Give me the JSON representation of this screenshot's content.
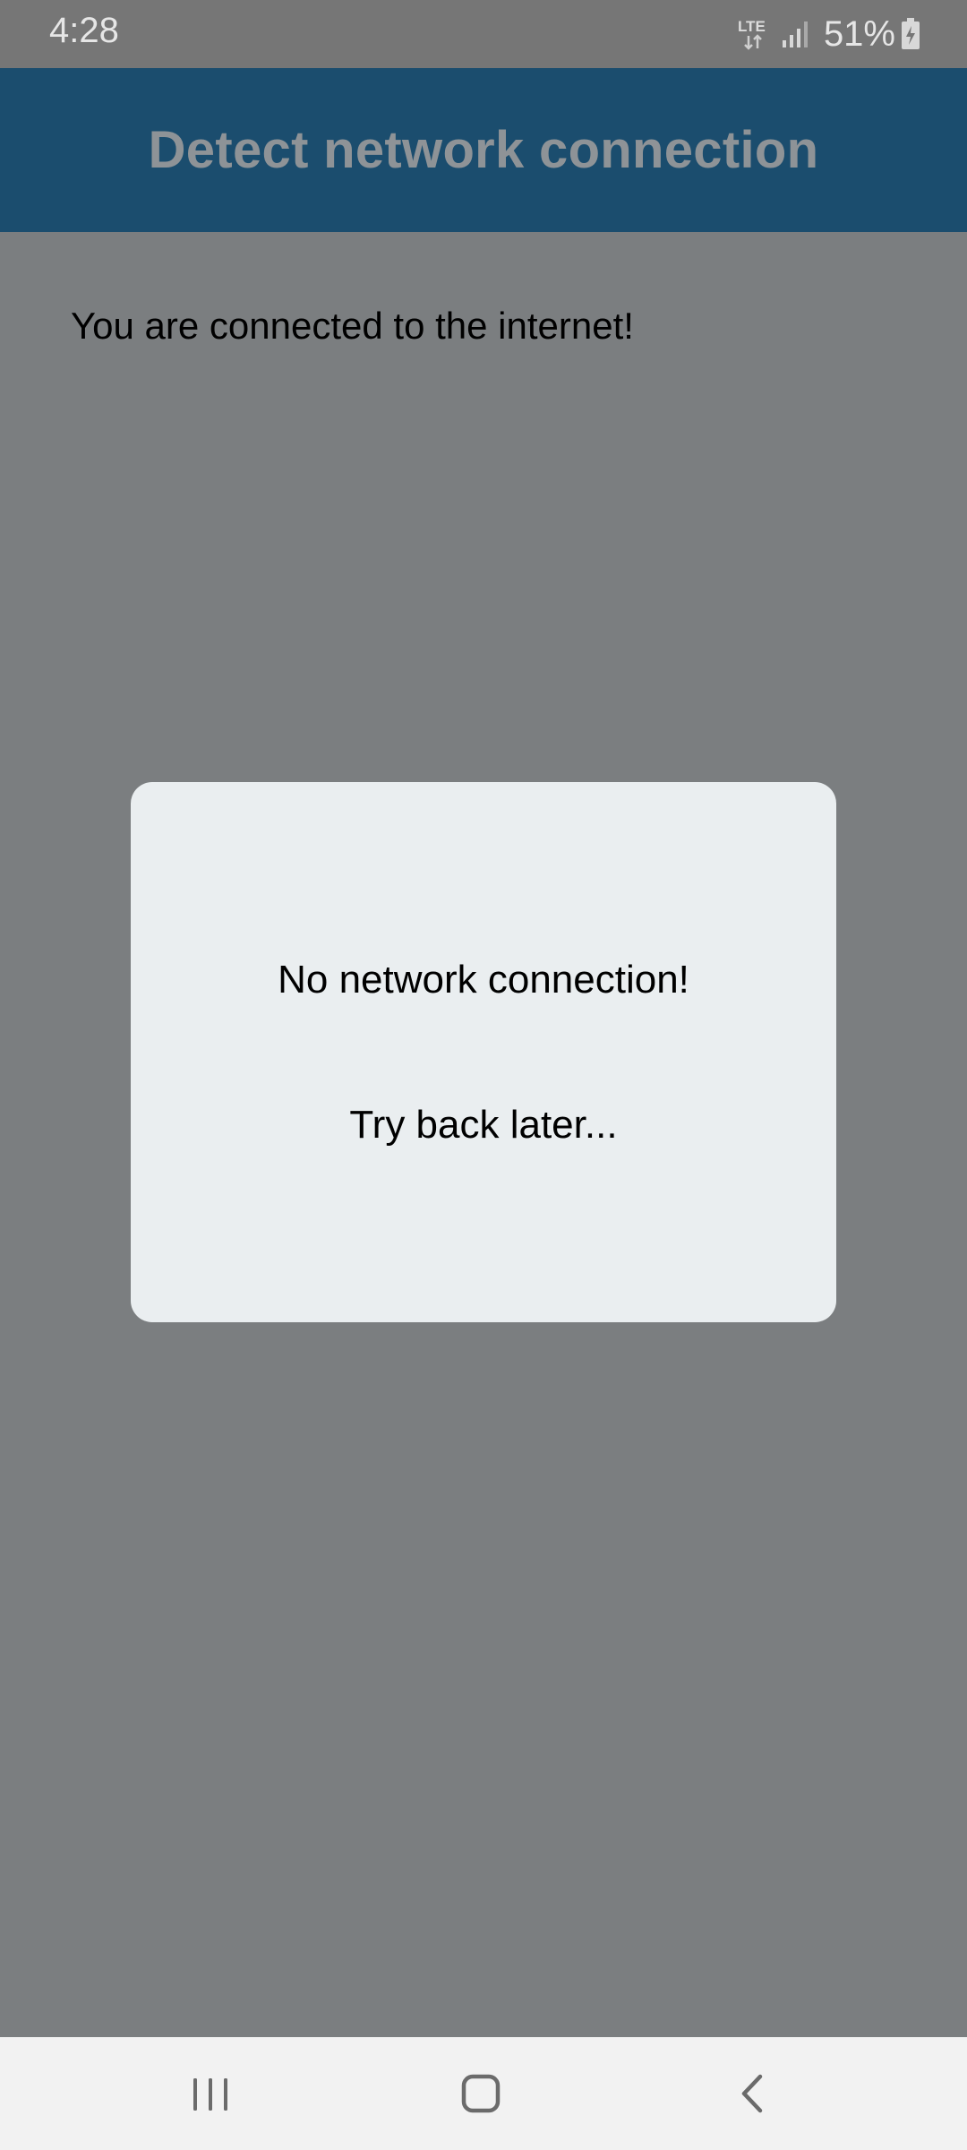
{
  "status_bar": {
    "time": "4:28",
    "network_type": "LTE",
    "battery_percent": "51%",
    "icons": [
      "lte-icon",
      "signal-icon",
      "battery-charging-icon"
    ]
  },
  "app_bar": {
    "title": "Detect network connection",
    "color": "#1b4d6e"
  },
  "main": {
    "status_message": "You are connected to the internet!"
  },
  "dialog": {
    "title": "No network connection!",
    "message": "Try back later..."
  },
  "nav_bar": {
    "icons": [
      "recent-apps-icon",
      "home-icon",
      "back-icon"
    ]
  },
  "colors": {
    "scrim": "#7b7e80",
    "dialog_bg": "#eaeef0",
    "app_bar": "#1b4d6e"
  }
}
